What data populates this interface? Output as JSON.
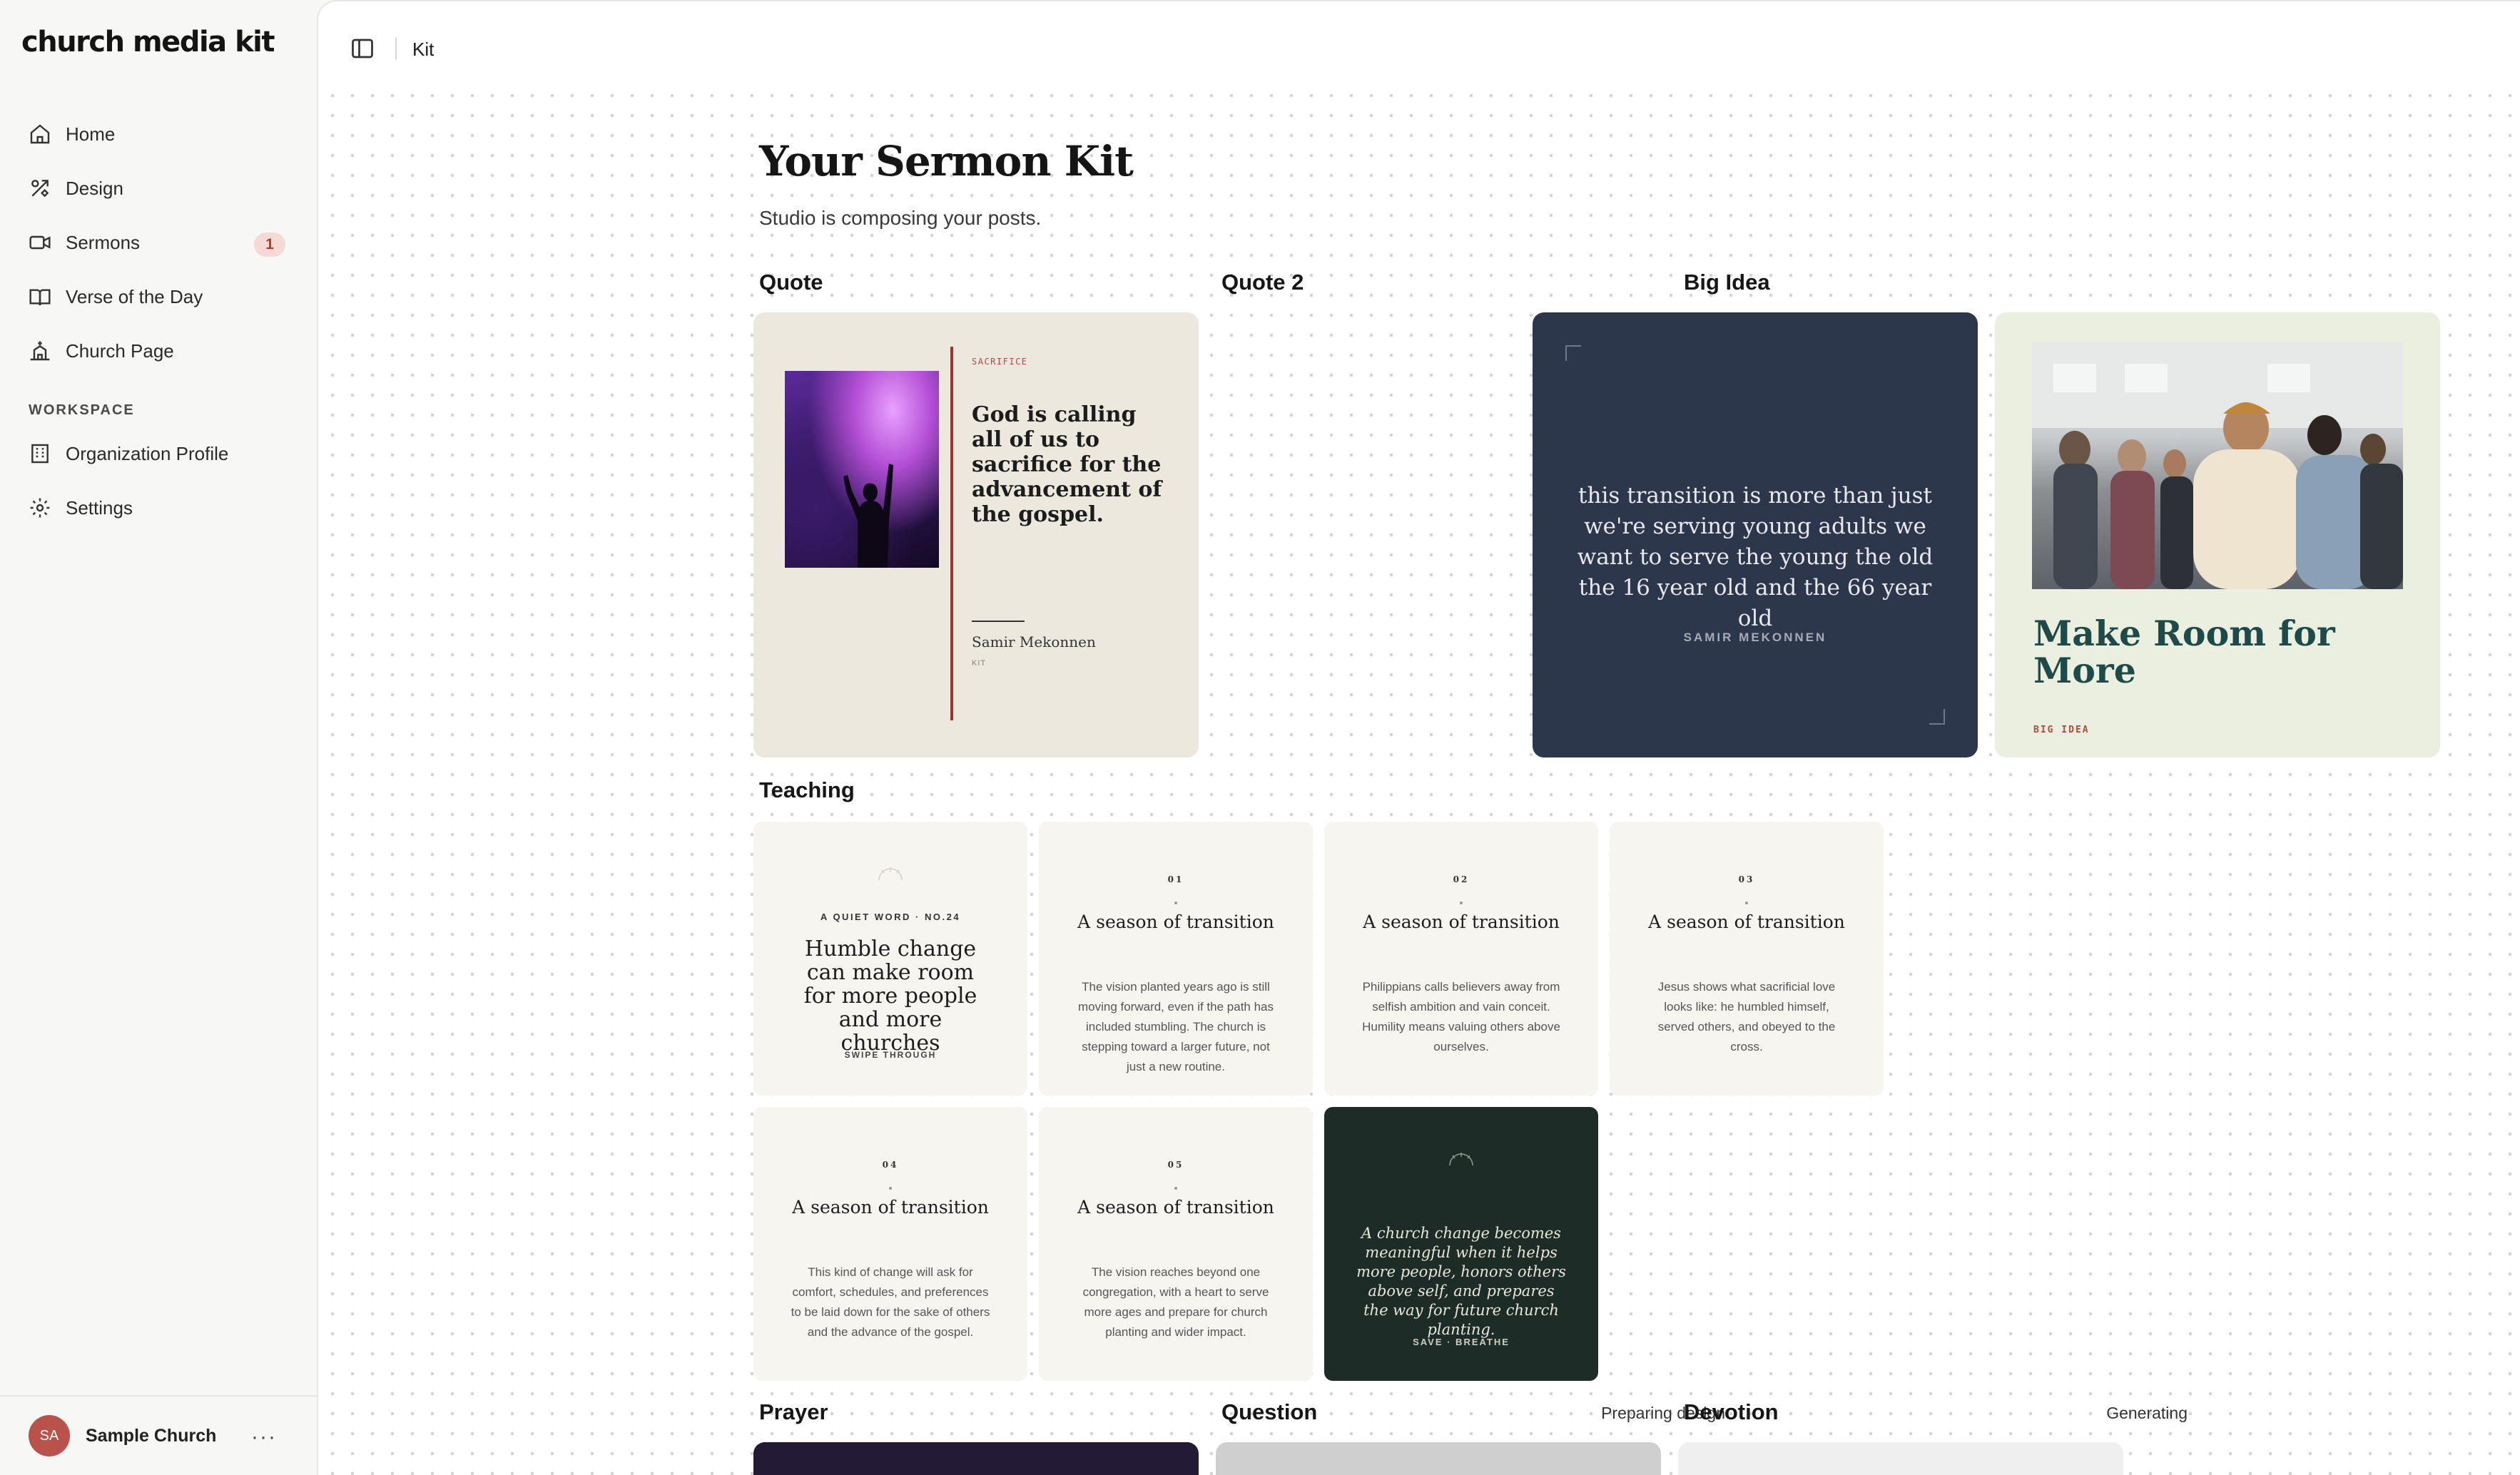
{
  "app": {
    "logo": "church media kit"
  },
  "sidebar": {
    "items": [
      {
        "label": "Home",
        "icon": "home-icon"
      },
      {
        "label": "Design",
        "icon": "design-icon"
      },
      {
        "label": "Sermons",
        "icon": "video-icon",
        "badge": "1"
      },
      {
        "label": "Verse of the Day",
        "icon": "book-icon"
      },
      {
        "label": "Church Page",
        "icon": "church-icon"
      }
    ],
    "workspace_label": "WORKSPACE",
    "workspace_items": [
      {
        "label": "Organization Profile",
        "icon": "building-icon"
      },
      {
        "label": "Settings",
        "icon": "gear-icon"
      }
    ],
    "footer": {
      "initials": "SA",
      "name": "Sample Church",
      "more": "···"
    }
  },
  "topbar": {
    "title": "Kit"
  },
  "page": {
    "title": "Your Sermon Kit",
    "subtitle": "Studio is composing your posts."
  },
  "sections": {
    "quote": "Quote",
    "quote2": "Quote 2",
    "big_idea": "Big Idea",
    "teaching": "Teaching",
    "prayer": "Prayer",
    "question": "Question",
    "question_status": "Preparing design",
    "devotion": "Devotion",
    "devotion_status": "Generating"
  },
  "quote_card": {
    "kicker": "SACRIFICE",
    "quote": "God is calling all of us to sacrifice for the advancement of the gospel.",
    "author": "Samir Mekonnen",
    "tag": "KIT"
  },
  "quote2_card": {
    "quote": "this transition is more than just we're serving young adults we want to serve the young the old the 16 year old and the 66 year old",
    "author": "SAMIR MEKONNEN"
  },
  "big_idea_card": {
    "title": "Make Room for More",
    "tag": "BIG IDEA"
  },
  "teaching": {
    "cover": {
      "kicker": "A QUIET WORD · NO.24",
      "title": "Humble change can make room for more people and more churches",
      "swipe": "SWIPE THROUGH"
    },
    "slides": [
      {
        "num": "01",
        "title": "A season of transition",
        "body": "The vision planted years ago is still moving forward, even if the path has included stumbling. The church is stepping toward a larger future, not just a new routine."
      },
      {
        "num": "02",
        "title": "A season of transition",
        "body": "Philippians calls believers away from selfish ambition and vain conceit. Humility means valuing others above ourselves."
      },
      {
        "num": "03",
        "title": "A season of transition",
        "body": "Jesus shows what sacrificial love looks like: he humbled himself, served others, and obeyed to the cross."
      },
      {
        "num": "04",
        "title": "A season of transition",
        "body": "This kind of change will ask for comfort, schedules, and preferences to be laid down for the sake of others and the advance of the gospel."
      },
      {
        "num": "05",
        "title": "A season of transition",
        "body": "The vision reaches beyond one congregation, with a heart to serve more ages and prepare for church planting and wider impact."
      }
    ],
    "closing": {
      "quote": "A church change becomes meaningful when it helps more people, honors others above self, and prepares the way for future church planting.",
      "tag": "SAVE · BREATHE"
    }
  },
  "colors": {
    "accent_red": "#a3302e",
    "quote2_bg": "#2d374b",
    "big_idea_bg": "#ebefe0",
    "big_idea_title": "#1e4a49",
    "teaching_dark": "#1e2c27",
    "badge_bg": "#f6d9d5"
  }
}
